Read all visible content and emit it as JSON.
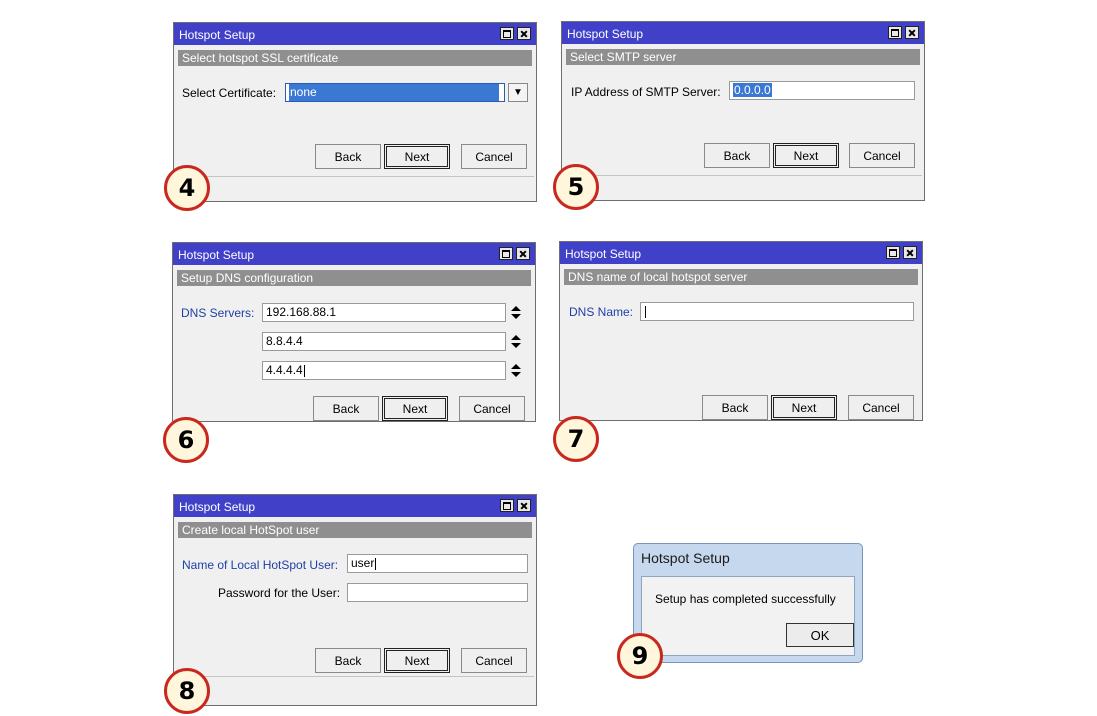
{
  "common": {
    "window_title": "Hotspot Setup",
    "back_label": "Back",
    "next_label": "Next",
    "cancel_label": "Cancel"
  },
  "step4": {
    "badge": "4",
    "section": "Select hotspot SSL certificate",
    "label": "Select Certificate:",
    "value": "none"
  },
  "step5": {
    "badge": "5",
    "section": "Select SMTP server",
    "label": "IP Address of SMTP Server:",
    "value": "0.0.0.0"
  },
  "step6": {
    "badge": "6",
    "section": "Setup DNS configuration",
    "label": "DNS Servers:",
    "servers": [
      "192.168.88.1",
      "8.8.4.4",
      "4.4.4.4"
    ]
  },
  "step7": {
    "badge": "7",
    "section": "DNS name of local hotspot server",
    "label": "DNS Name:",
    "value": ""
  },
  "step8": {
    "badge": "8",
    "section": "Create local HotSpot user",
    "user_label": "Name of Local HotSpot User:",
    "user_value": "user",
    "password_label": "Password for the User:",
    "password_value": ""
  },
  "step9": {
    "badge": "9",
    "title": "Hotspot Setup",
    "message": "Setup has completed successfully",
    "ok_label": "OK"
  },
  "colors": {
    "titlebar": "#4040c8",
    "section_header": "#8f8f8f",
    "selection": "#3a78d4",
    "badge_ring": "#c8281e",
    "badge_fill": "#fff6dc"
  }
}
